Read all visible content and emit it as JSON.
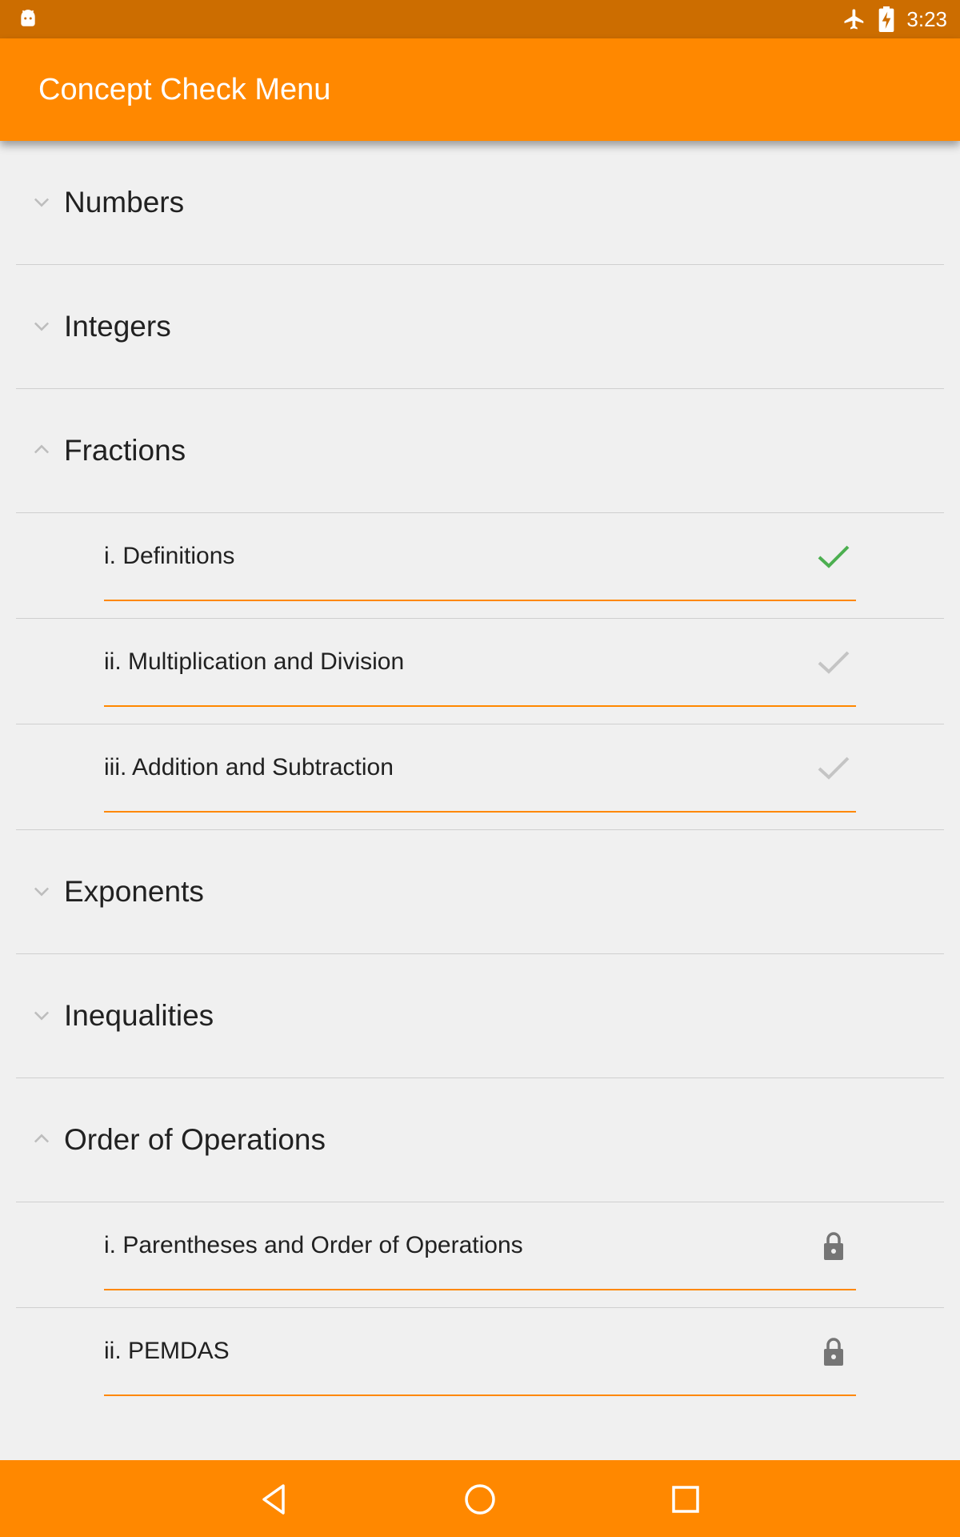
{
  "status_bar": {
    "time": "3:23",
    "icons": [
      "android-icon",
      "airplane-mode-icon",
      "battery-charging-icon"
    ],
    "color": "#cc6d00"
  },
  "app_bar": {
    "title": "Concept Check Menu",
    "color": "#ff8800"
  },
  "groups": [
    {
      "label": "Numbers",
      "expanded": false,
      "children": []
    },
    {
      "label": "Integers",
      "expanded": false,
      "children": []
    },
    {
      "label": "Fractions",
      "expanded": true,
      "children": [
        {
          "label": "i. Definitions",
          "status": "completed"
        },
        {
          "label": "ii. Multiplication and Division",
          "status": "incomplete"
        },
        {
          "label": "iii. Addition and Subtraction",
          "status": "incomplete"
        }
      ]
    },
    {
      "label": "Exponents",
      "expanded": false,
      "children": []
    },
    {
      "label": "Inequalities",
      "expanded": false,
      "children": []
    },
    {
      "label": "Order of Operations",
      "expanded": true,
      "children": [
        {
          "label": "i. Parentheses and Order of Operations",
          "status": "locked"
        },
        {
          "label": "ii. PEMDAS",
          "status": "locked"
        }
      ]
    }
  ],
  "colors": {
    "accent": "#ff8800",
    "completed_check": "#4caf50",
    "incomplete_check": "#c4c4c4",
    "lock": "#757575"
  },
  "nav_bar": {
    "buttons": [
      "back-icon",
      "home-icon",
      "recents-icon"
    ]
  }
}
